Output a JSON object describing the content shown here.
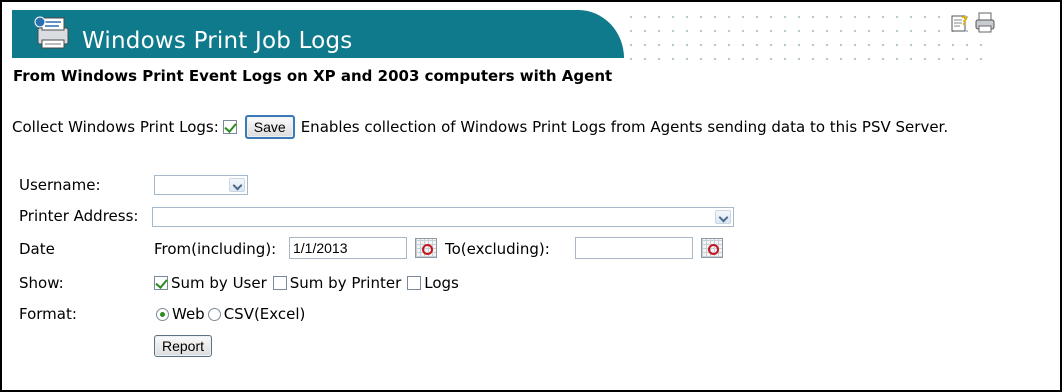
{
  "header": {
    "title": "Windows Print Job Logs",
    "icons": [
      "help-icon",
      "printer-icon"
    ]
  },
  "subtitle": "From Windows Print Event Logs on XP and 2003 computers with Agent",
  "collect": {
    "label": "Collect Windows Print Logs:",
    "checked": true,
    "save_label": "Save",
    "description": "Enables collection of Windows Print Logs from Agents sending data to this PSV Server."
  },
  "form": {
    "username_label": "Username:",
    "username_value": "",
    "printer_label": "Printer Address:",
    "printer_value": "",
    "date_label": "Date",
    "from_label": "From(including):",
    "from_value": "1/1/2013",
    "to_label": "To(excluding):",
    "to_value": "",
    "show_label": "Show:",
    "show_options": [
      {
        "label": "Sum by User",
        "checked": true
      },
      {
        "label": "Sum by Printer",
        "checked": false
      },
      {
        "label": "Logs",
        "checked": false
      }
    ],
    "format_label": "Format:",
    "format_options": [
      {
        "label": "Web",
        "selected": true
      },
      {
        "label": "CSV(Excel)",
        "selected": false
      }
    ],
    "report_label": "Report"
  },
  "colors": {
    "banner": "#0f7a8c",
    "check": "#2c8c1e"
  }
}
